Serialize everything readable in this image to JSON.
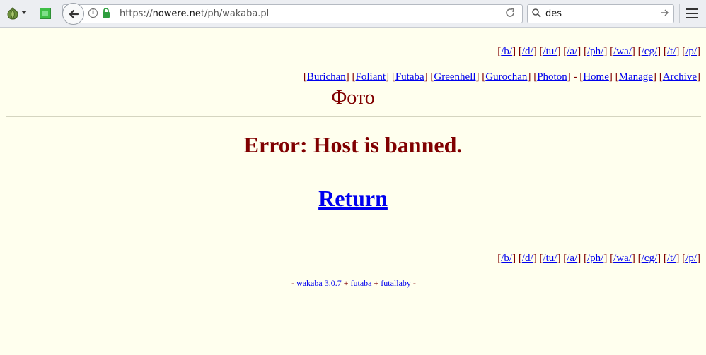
{
  "browser": {
    "url_prefix": "https://",
    "url_domain": "nowere.net",
    "url_path": "/ph/wakaba.pl",
    "search_value": "des",
    "info_glyph": "i"
  },
  "board_nav": [
    "/b/",
    "/d/",
    "/tu/",
    "/a/",
    "/ph/",
    "/wa/",
    "/cg/",
    "/t/",
    "/p/"
  ],
  "site_nav": {
    "sites": [
      "Burichan",
      "Foliant",
      "Futaba",
      "Greenhell",
      "Gurochan",
      "Photon"
    ],
    "separator": " - ",
    "links": [
      "Home",
      "Manage",
      "Archive"
    ]
  },
  "logo": "Фото",
  "error": {
    "message": "Error: Host is banned.",
    "return_label": "Return"
  },
  "footer": {
    "prefix": "- ",
    "links": [
      "wakaba 3.0.7",
      "futaba",
      "futallaby"
    ],
    "joiner": " + ",
    "suffix": " -"
  },
  "colors": {
    "page_bg": "#FFFFEE",
    "text": "#800000",
    "link": "#0000EE"
  }
}
